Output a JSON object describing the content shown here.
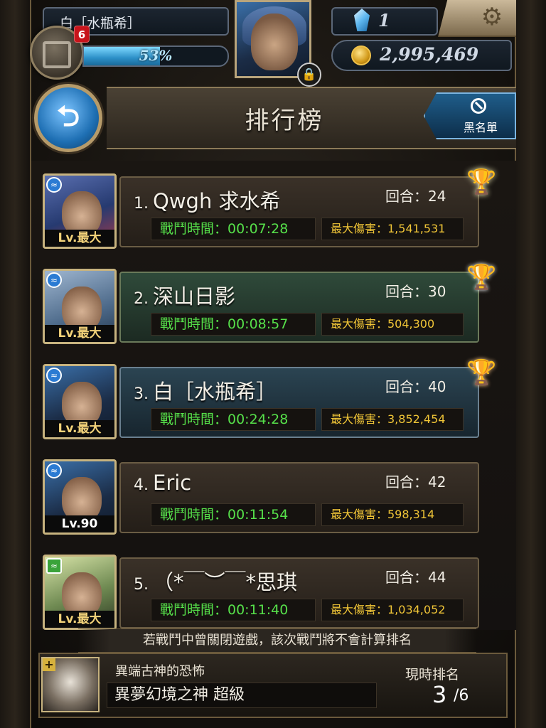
{
  "player": {
    "name": "白［水瓶希］",
    "notification_count": "6",
    "exp_percent": "53%",
    "exp_fraction": 0.53,
    "gems": "1",
    "coins": "2,995,469"
  },
  "header": {
    "title": "排行榜",
    "blacklist_label": "黑名單"
  },
  "rankings": [
    {
      "rank": "1.",
      "name": "Qwgh 求水希",
      "rounds": "回合：24",
      "time": "戰鬥時間：00:07:28",
      "damage": "最大傷害：1,541,531",
      "level": "Lv.最大",
      "trophy": "gold",
      "style": "plain"
    },
    {
      "rank": "2.",
      "name": "深山日影",
      "rounds": "回合：30",
      "time": "戰鬥時間：00:08:57",
      "damage": "最大傷害：504,300",
      "level": "Lv.最大",
      "trophy": "silver",
      "style": "green"
    },
    {
      "rank": "3.",
      "name": "白［水瓶希］",
      "rounds": "回合：40",
      "time": "戰鬥時間：00:24:28",
      "damage": "最大傷害：3,852,454",
      "level": "Lv.最大",
      "trophy": "bronze",
      "style": "blue"
    },
    {
      "rank": "4.",
      "name": "Eric",
      "rounds": "回合：42",
      "time": "戰鬥時間：00:11:54",
      "damage": "最大傷害：598,314",
      "level": "Lv.90",
      "trophy": "",
      "style": "plain"
    },
    {
      "rank": "5.",
      "name": "（*￣︶￣*思琪",
      "rounds": "回合：44",
      "time": "戰鬥時間：00:11:40",
      "damage": "最大傷害：1,034,052",
      "level": "Lv.最大",
      "trophy": "",
      "style": "plain"
    }
  ],
  "footer": {
    "notice": "若戰鬥中曾關閉遊戲，該次戰鬥將不會計算排名",
    "boss_title": "異端古神的恐怖",
    "stage": "異夢幻境之神 超級",
    "rank_label": "現時排名",
    "current_rank": "3",
    "total": "/6"
  },
  "colors": {
    "time_text": "#56e04a",
    "damage_text": "#f0c537",
    "accent_blue": "#1e6fb3"
  }
}
